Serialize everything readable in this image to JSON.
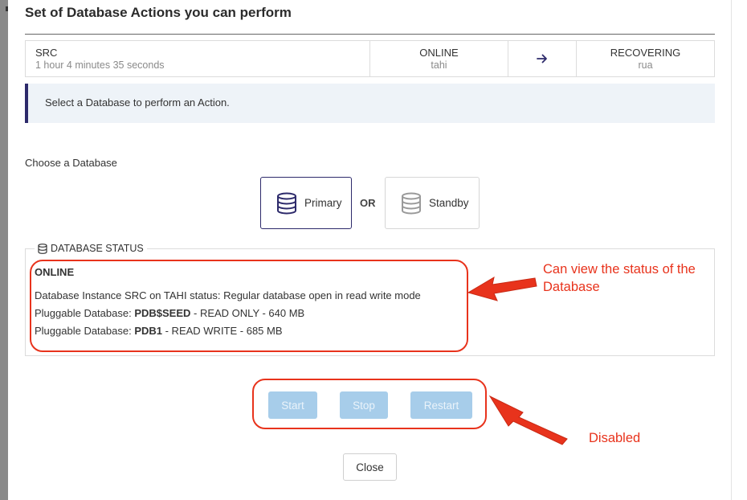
{
  "modal": {
    "title": "Set of Database Actions you can perform"
  },
  "sync": {
    "source_name": "SRC",
    "elapsed": "1 hour 4 minutes 35 seconds",
    "online_state": "ONLINE",
    "online_host": "tahi",
    "arrow_icon": "arrow-right-icon",
    "recovering_state": "RECOVERING",
    "recovering_host": "rua"
  },
  "banner": {
    "message": "Select a Database to perform an Action."
  },
  "chooser": {
    "label": "Choose a Database",
    "primary_label": "Primary",
    "or_label": "OR",
    "standby_label": "Standby",
    "selected": "Primary"
  },
  "status": {
    "legend": "DATABASE STATUS",
    "state": "ONLINE",
    "instance_line": "Database Instance SRC on TAHI status: Regular database open in read write mode",
    "pdb_prefix": "Pluggable Database: ",
    "pdbs": [
      {
        "name": "PDB$SEED",
        "detail": " - READ ONLY - 640 MB"
      },
      {
        "name": "PDB1",
        "detail": " - READ WRITE - 685 MB"
      }
    ]
  },
  "actions": {
    "start_label": "Start",
    "stop_label": "Stop",
    "restart_label": "Restart",
    "close_label": "Close",
    "disabled_color": "#a7cdea"
  },
  "annotations": {
    "status_note_line1": "Can view the status of the",
    "status_note_line2": "Database",
    "disabled_note": "Disabled",
    "color": "#e8331c"
  }
}
